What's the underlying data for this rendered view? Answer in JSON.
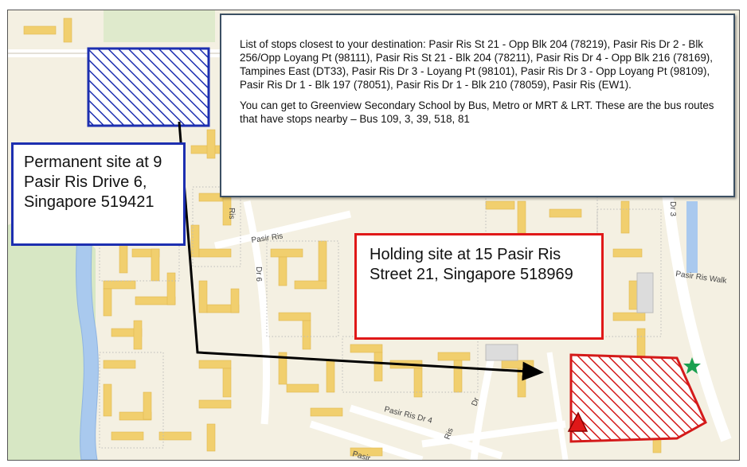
{
  "info": {
    "stops_text": "List of stops closest to your destination: Pasir Ris St 21 - Opp Blk 204 (78219), Pasir Ris Dr 2 - Blk 256/Opp Loyang Pt (98111), Pasir Ris St 21 - Blk 204 (78211), Pasir Ris Dr 4 - Opp Blk 216 (78169), Tampines East (DT33), Pasir Ris Dr 3 - Loyang Pt (98101), Pasir Ris Dr 3 - Opp Loyang Pt (98109), Pasir Ris Dr 1 - Blk 197 (78051), Pasir Ris Dr 1 - Blk 210 (78059), Pasir Ris (EW1).",
    "routes_text": "You can get to Greenview Secondary School by Bus, Metro or MRT & LRT. These are the bus routes that have stops nearby – Bus 109, 3, 39, 518, 81"
  },
  "permanent_site": {
    "label": "Permanent site at 9 Pasir Ris Drive 6, Singapore 519421",
    "color": "#1d2fb0"
  },
  "holding_site": {
    "label": "Holding site at 15 Pasir Ris Street 21, Singapore 518969",
    "color": "#e01818"
  },
  "map": {
    "street_labels": {
      "pasir_ris_1": "Pasir Ris",
      "ris": "Ris",
      "dr_6": "Dr 6",
      "dr_3": "Dr 3",
      "pasir_ris_walk": "Pasir Ris Walk",
      "pasir_ris_dr4": "Pasir Ris Dr 4",
      "ris_2": "Ris",
      "dr_2": "Dr",
      "pasir_2": "Pasir"
    },
    "markers": {
      "star_color": "#1aa050",
      "triangle_color": "#e01818"
    }
  }
}
